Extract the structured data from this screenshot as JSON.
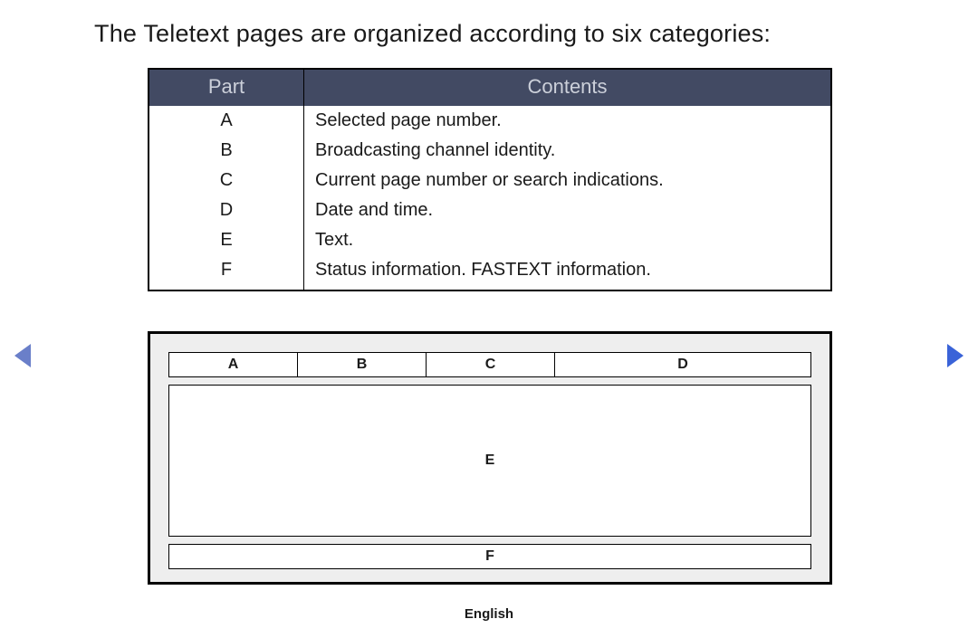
{
  "title": "The Teletext pages are organized according to six categories:",
  "table": {
    "headers": {
      "part": "Part",
      "contents": "Contents"
    },
    "rows": [
      {
        "part": "A",
        "contents": "Selected page number."
      },
      {
        "part": "B",
        "contents": "Broadcasting channel identity."
      },
      {
        "part": "C",
        "contents": "Current page number or search indications."
      },
      {
        "part": "D",
        "contents": "Date and time."
      },
      {
        "part": "E",
        "contents": "Text."
      },
      {
        "part": "F",
        "contents": "Status information. FASTEXT information."
      }
    ]
  },
  "diagram": {
    "top": [
      "A",
      "B",
      "C",
      "D"
    ],
    "middle": "E",
    "bottom": "F"
  },
  "footer": {
    "language": "English"
  }
}
